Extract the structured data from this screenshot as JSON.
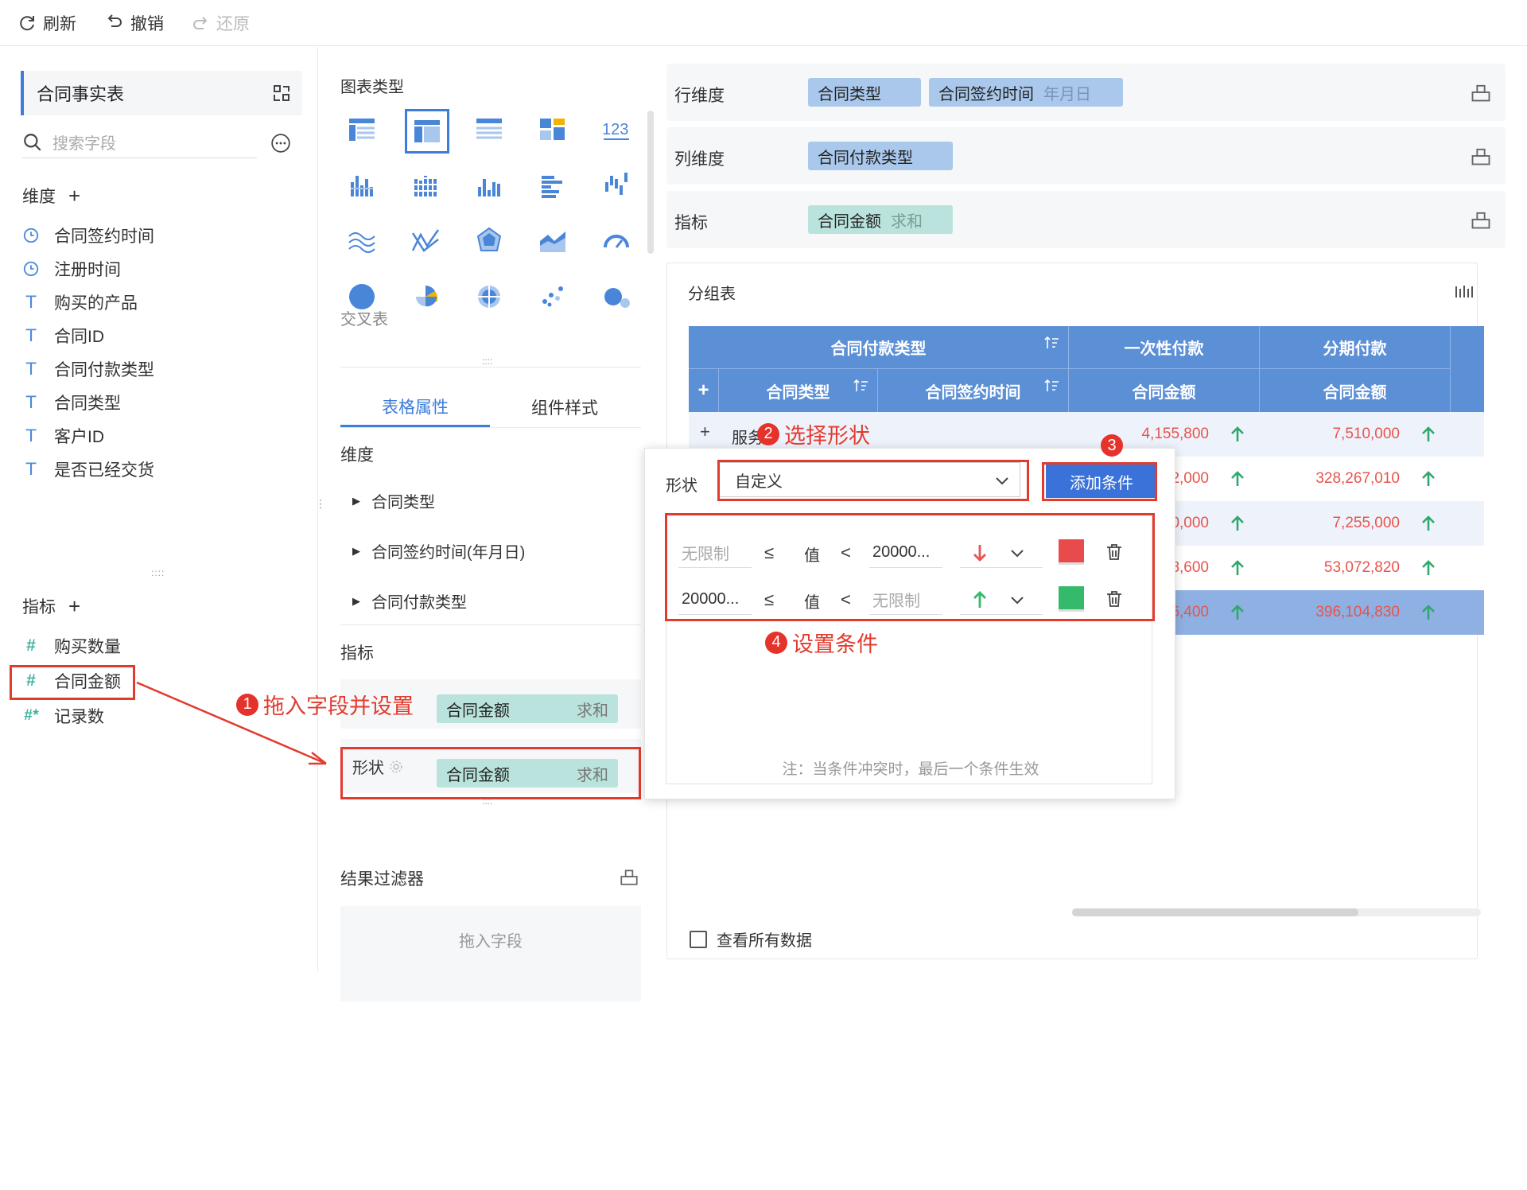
{
  "toolbar": {
    "refresh": "刷新",
    "undo": "撤销",
    "redo": "还原"
  },
  "left": {
    "dataset": "合同事实表",
    "search_placeholder": "搜索字段",
    "dim_title": "维度",
    "dims": [
      {
        "icon": "clock-icon",
        "label": "合同签约时间"
      },
      {
        "icon": "clock-icon",
        "label": "注册时间"
      },
      {
        "icon": "text-type-icon",
        "label": "购买的产品"
      },
      {
        "icon": "text-type-icon",
        "label": "合同ID"
      },
      {
        "icon": "text-type-icon",
        "label": "合同付款类型"
      },
      {
        "icon": "text-type-icon",
        "label": "合同类型"
      },
      {
        "icon": "text-type-icon",
        "label": "客户ID"
      },
      {
        "icon": "text-type-icon",
        "label": "是否已经交货"
      }
    ],
    "metric_title": "指标",
    "metrics": [
      {
        "icon": "number-type-icon",
        "label": "购买数量"
      },
      {
        "icon": "number-type-icon",
        "label": "合同金额"
      },
      {
        "icon": "number-type-icon",
        "label": "记录数"
      }
    ]
  },
  "mid": {
    "chart_type_title": "图表类型",
    "chart_type_hover": "交叉表",
    "tabs": [
      "表格属性",
      "组件样式"
    ],
    "dim_section": "维度",
    "dim_items": [
      "合同类型",
      "合同签约时间(年月日)",
      "合同付款类型"
    ],
    "metric_section": "指标",
    "metric_pill": {
      "name": "合同金额",
      "agg": "求和"
    },
    "shape_label": "形状",
    "shape_pill": {
      "name": "合同金额",
      "agg": "求和"
    },
    "filter_title": "结果过滤器",
    "filter_drop": "拖入字段"
  },
  "right": {
    "row_dim_label": "行维度",
    "row_dims": [
      "合同类型",
      "合同签约时间"
    ],
    "row_dim_suffix": "年月日",
    "col_dim_label": "列维度",
    "col_dims": [
      "合同付款类型"
    ],
    "metric_label": "指标",
    "metric_pill": {
      "name": "合同金额",
      "agg": "求和"
    },
    "table_title": "分组表",
    "view_all": "查看所有数据"
  },
  "table": {
    "h1": "合同付款类型",
    "h_once": "一次性付款",
    "h_inst": "分期付款",
    "h_type": "合同类型",
    "h_time": "合同签约时间",
    "h_amt": "合同金额",
    "expand": "+",
    "row1_label": "服务",
    "col_once": [
      "4,155,800",
      "2,000",
      "0,000",
      "8,600",
      "6,400"
    ],
    "col_inst": [
      "7,510,000",
      "328,267,010",
      "7,255,000",
      "53,072,820",
      "396,104,830"
    ]
  },
  "popup": {
    "shape_label": "形状",
    "shape_value": "自定义",
    "add_button": "添加条件",
    "conds": [
      {
        "min": "无限制",
        "op1": "≤",
        "val": "值",
        "op2": "<",
        "max": "20000...",
        "arrow": "down",
        "color": "#e84b4b"
      },
      {
        "min": "20000...",
        "op1": "≤",
        "val": "值",
        "op2": "<",
        "max": "无限制",
        "arrow": "up",
        "color": "#35b96b"
      }
    ],
    "note": "注：当条件冲突时，最后一个条件生效"
  },
  "annotations": {
    "a1": "拖入字段并设置",
    "a2": "选择形状",
    "a3": "",
    "a4": "设置条件",
    "n1": "1",
    "n2": "2",
    "n3": "3",
    "n4": "4"
  }
}
